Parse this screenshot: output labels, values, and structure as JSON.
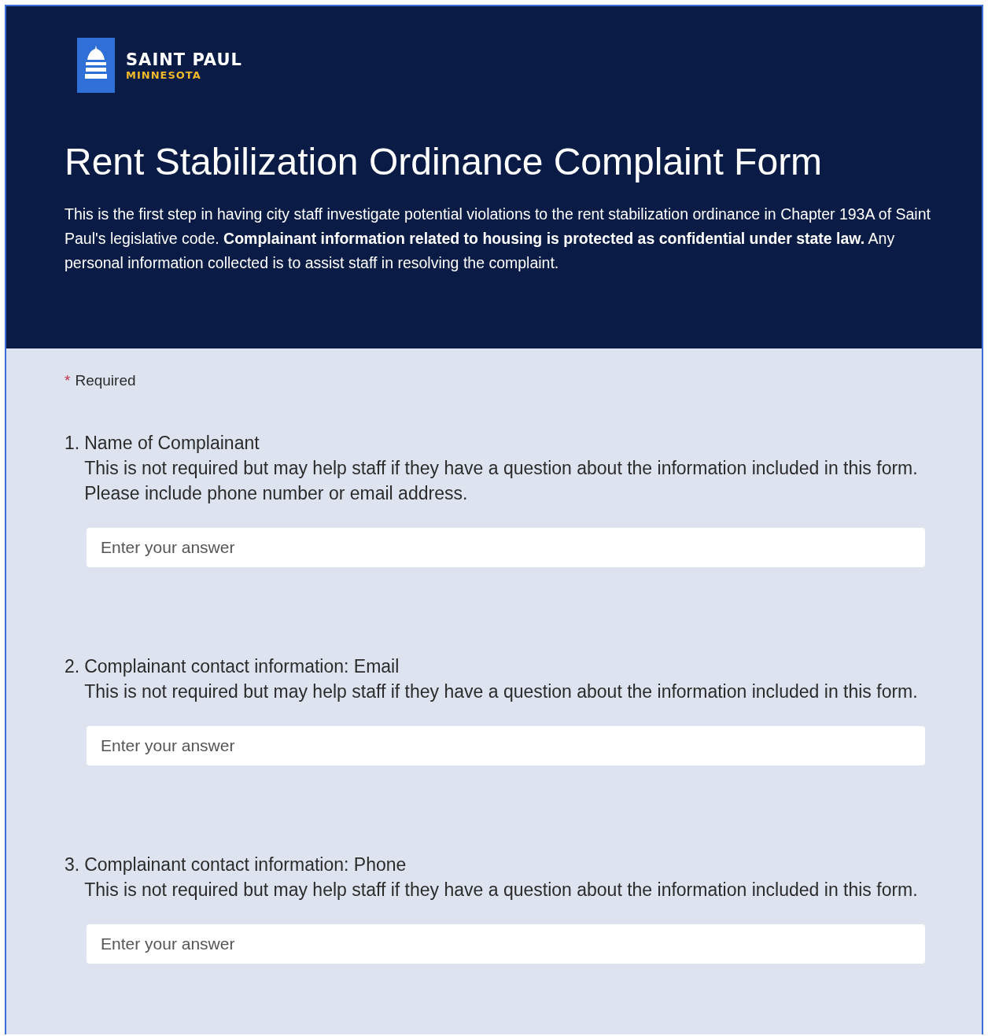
{
  "header": {
    "logo": {
      "name": "SAINT PAUL",
      "subtitle": "MINNESOTA"
    },
    "title": "Rent Stabilization Ordinance Complaint Form",
    "description": "This is the first step in having city staff investigate potential violations to the rent stabilization ordinance in Chapter 193A of Saint Paul's legislative code.  **Complainant information related to housing is protected as confidential under state law.**  Any personal information collected is to assist staff in resolving the complaint."
  },
  "required_note": {
    "mark": "*",
    "label": "Required"
  },
  "questions": [
    {
      "number": "1.",
      "title": "Name of Complainant",
      "description": "This is not required but may help staff if they have a question about the information included in this form.  Please include phone number or email address.",
      "placeholder": "Enter your answer"
    },
    {
      "number": "2.",
      "title": "Complainant contact information: Email",
      "description": "This is not required but may help staff if they have a question about the information included in this form.",
      "placeholder": "Enter your answer"
    },
    {
      "number": "3.",
      "title": "Complainant contact information: Phone",
      "description": "This is not required but may help staff if they have a question about the information included in this form.",
      "placeholder": "Enter your answer"
    }
  ]
}
